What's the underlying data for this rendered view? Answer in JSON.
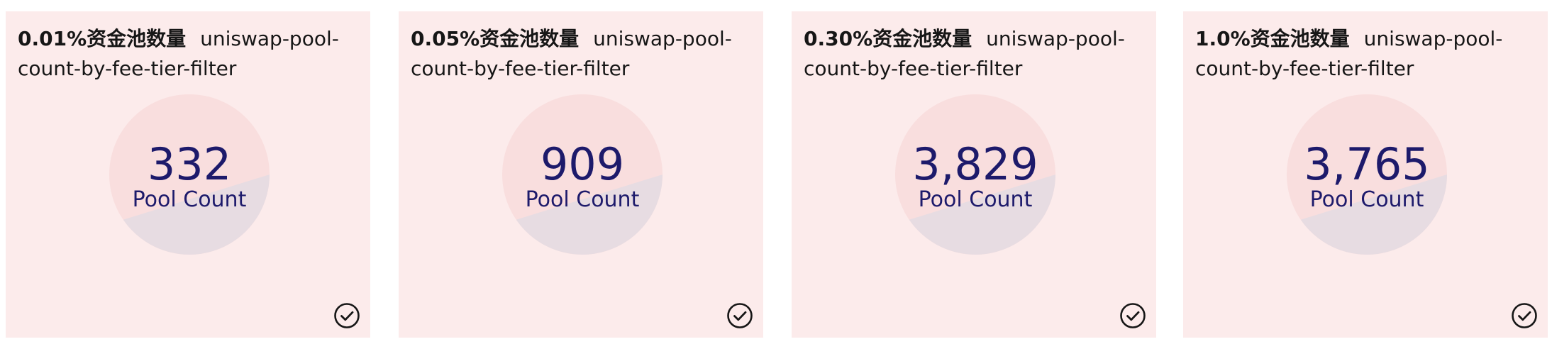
{
  "theme": {
    "card_background": "#fcebeb",
    "circle_top_color": "#f9dede",
    "circle_bottom_color": "#e7dce2",
    "value_color": "#1d1a6b",
    "text_color": "#161616"
  },
  "cards": [
    {
      "fee_label": "0.01%资金池数量",
      "filter_name": "uniswap-pool-count-by-fee-tier-filter",
      "value": "332",
      "value_label": "Pool Count",
      "status_icon": "check-circle-icon"
    },
    {
      "fee_label": "0.05%资金池数量",
      "filter_name": "uniswap-pool-count-by-fee-tier-filter",
      "value": "909",
      "value_label": "Pool Count",
      "status_icon": "check-circle-icon"
    },
    {
      "fee_label": "0.30%资金池数量",
      "filter_name": "uniswap-pool-count-by-fee-tier-filter",
      "value": "3,829",
      "value_label": "Pool Count",
      "status_icon": "check-circle-icon"
    },
    {
      "fee_label": "1.0%资金池数量",
      "filter_name": "uniswap-pool-count-by-fee-tier-filter",
      "value": "3,765",
      "value_label": "Pool Count",
      "status_icon": "check-circle-icon"
    }
  ]
}
